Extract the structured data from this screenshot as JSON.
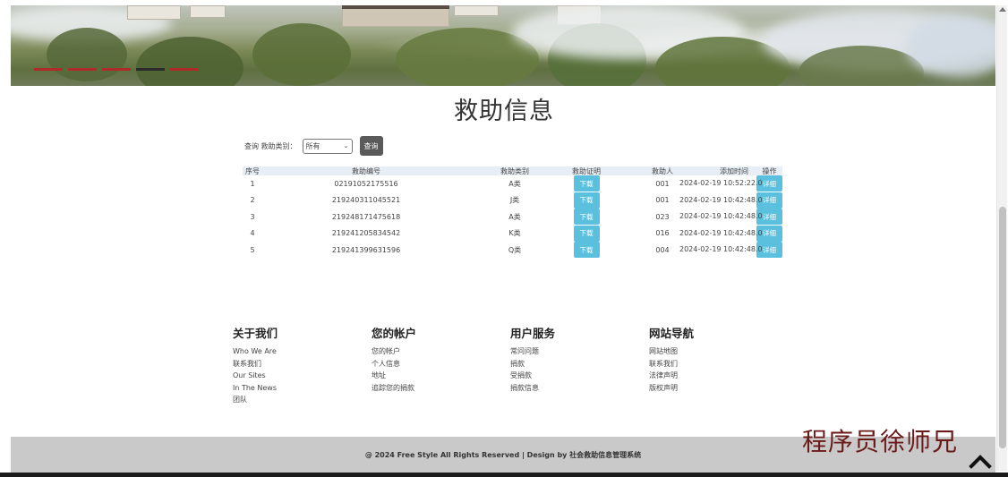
{
  "banner": {
    "slides": 5,
    "active_slide": 3
  },
  "page": {
    "title": "救助信息"
  },
  "query": {
    "label": "查询 救助类别：",
    "selected": "所有",
    "button": "查询"
  },
  "table": {
    "headers": {
      "index": "序号",
      "number": "救助编号",
      "type": "救助类别",
      "proof": "救助证明",
      "person": "救助人",
      "time": "添加时间",
      "action": "操作"
    },
    "rows": [
      {
        "index": "1",
        "number": "02191052175516",
        "type": "A类",
        "download": "下载",
        "person": "001",
        "time": "2024-02-19 10:52:22.0",
        "detail": "详细"
      },
      {
        "index": "2",
        "number": "219240311045521",
        "type": "J类",
        "download": "下载",
        "person": "001",
        "time": "2024-02-19 10:42:48.0",
        "detail": "详细"
      },
      {
        "index": "3",
        "number": "219248171475618",
        "type": "A类",
        "download": "下载",
        "person": "023",
        "time": "2024-02-19 10:42:48.0",
        "detail": "详细"
      },
      {
        "index": "4",
        "number": "219241205834542",
        "type": "K类",
        "download": "下载",
        "person": "016",
        "time": "2024-02-19 10:42:48.0",
        "detail": "详细"
      },
      {
        "index": "5",
        "number": "219241399631596",
        "type": "Q类",
        "download": "下载",
        "person": "004",
        "time": "2024-02-19 10:42:48.0",
        "detail": "详细"
      }
    ]
  },
  "footer": {
    "columns": [
      {
        "title": "关于我们",
        "links": [
          "Who We Are",
          "联系我们",
          "Our Sites",
          "In The News",
          "团队"
        ]
      },
      {
        "title": "您的帐户",
        "links": [
          "您的帐户",
          "个人信息",
          "地址",
          "追踪您的捐款"
        ]
      },
      {
        "title": "用户服务",
        "links": [
          "常问问题",
          "捐款",
          "受捐款",
          "捐款信息"
        ]
      },
      {
        "title": "网站导航",
        "links": [
          "网站地图",
          "联系我们",
          "法律声明",
          "版权声明"
        ]
      }
    ],
    "copyright": "@ 2024 Free Style All Rights Reserved | Design by 社会救助信息管理系统"
  },
  "watermark": "程序员徐师兄",
  "colors": {
    "accent_button": "#5bc0de",
    "query_button": "#5a5a5a",
    "slider_dot": "#b02a2a",
    "slider_dot_active": "#2b2b2b",
    "footer_bar": "#c9c9c9",
    "watermark": "#6b1a1a"
  },
  "icons": {
    "select_arrow": "chevron-down-icon",
    "back_to_top": "chevron-up-icon"
  }
}
